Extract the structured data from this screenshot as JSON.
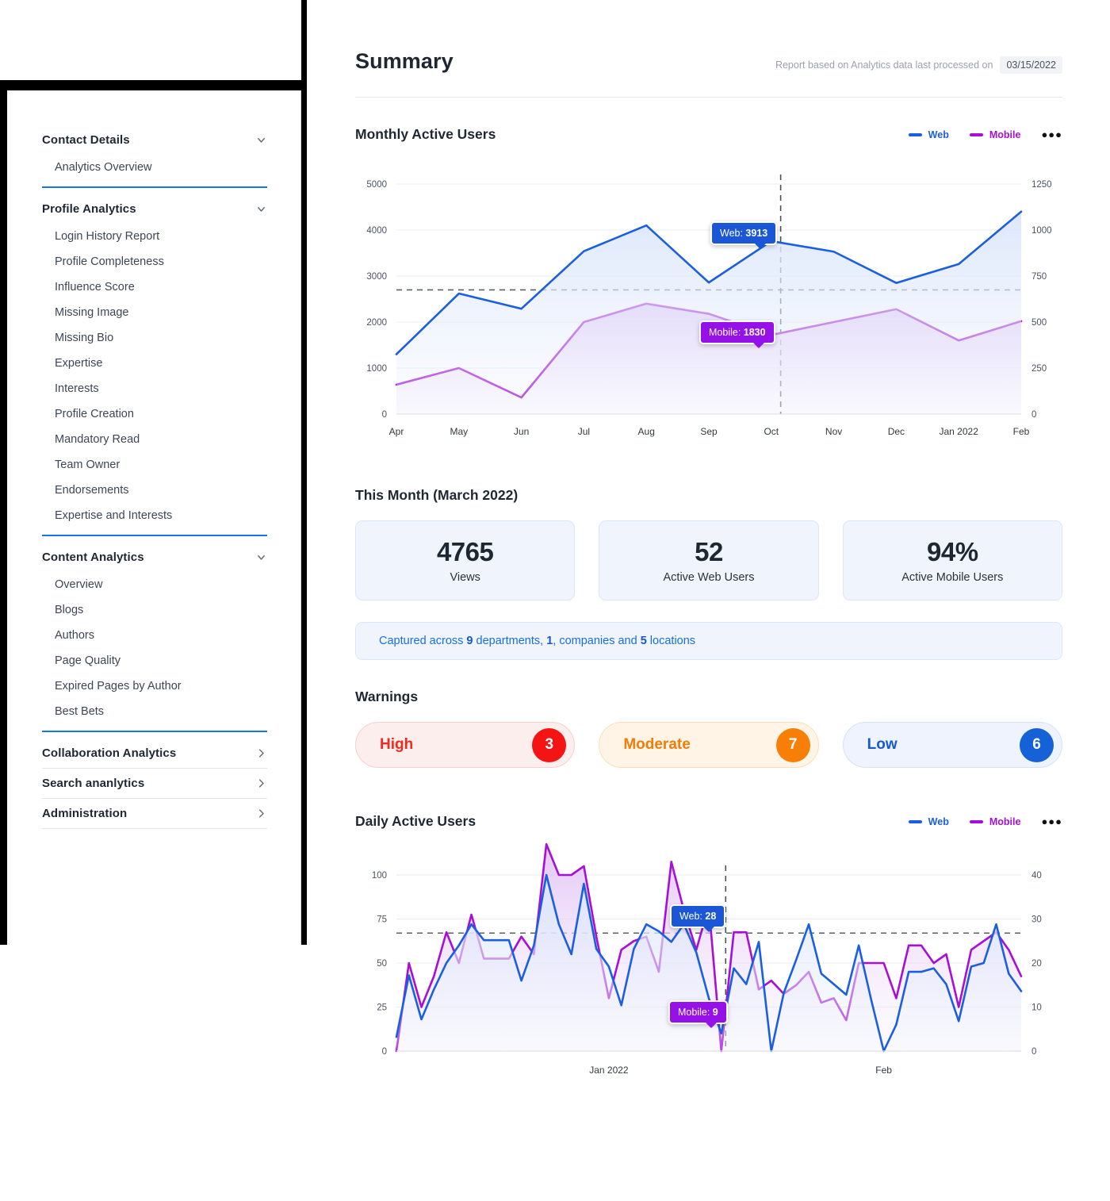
{
  "sidebar": {
    "groups": [
      {
        "title": "Contact Details",
        "icon": "chevron-down-icon",
        "expanded": true,
        "accent_rule": true,
        "items": [
          {
            "label": "Analytics Overview"
          }
        ]
      },
      {
        "title": "Profile Analytics",
        "icon": "chevron-down-icon",
        "expanded": true,
        "accent_rule": true,
        "items": [
          {
            "label": "Login History Report"
          },
          {
            "label": "Profile Completeness"
          },
          {
            "label": "Influence Score"
          },
          {
            "label": "Missing Image"
          },
          {
            "label": "Missing Bio"
          },
          {
            "label": "Expertise"
          },
          {
            "label": "Interests"
          },
          {
            "label": "Profile Creation"
          },
          {
            "label": "Mandatory Read"
          },
          {
            "label": "Team Owner"
          },
          {
            "label": "Endorsements"
          },
          {
            "label": "Expertise and Interests"
          }
        ]
      },
      {
        "title": "Content Analytics",
        "icon": "chevron-down-icon",
        "expanded": true,
        "accent_rule": true,
        "items": [
          {
            "label": "Overview"
          },
          {
            "label": "Blogs"
          },
          {
            "label": "Authors"
          },
          {
            "label": "Page Quality"
          },
          {
            "label": "Expired Pages by Author"
          },
          {
            "label": "Best Bets"
          }
        ]
      },
      {
        "title": "Collaboration Analytics",
        "icon": "chevron-right-icon",
        "expanded": false,
        "accent_rule": false,
        "items": []
      },
      {
        "title": "Search ananlytics",
        "icon": "chevron-right-icon",
        "expanded": false,
        "accent_rule": false,
        "items": []
      },
      {
        "title": "Administration",
        "icon": "chevron-right-icon",
        "expanded": false,
        "accent_rule": false,
        "items": []
      }
    ]
  },
  "header": {
    "title": "Summary",
    "report_note": "Report based on Analytics data last processed on",
    "report_date": "03/15/2022"
  },
  "monthly": {
    "title": "Monthly Active Users",
    "legend": [
      {
        "label": "Web",
        "color": "#1a5fe0"
      },
      {
        "label": "Mobile",
        "color": "#a70fd6"
      }
    ],
    "menu_icon": "more-horizontal-icon",
    "tooltip_web": {
      "prefix": "Web: ",
      "value": "3913"
    },
    "tooltip_mobile": {
      "prefix": "Mobile: ",
      "value": "1830"
    }
  },
  "this_month": {
    "title": "This Month (March 2022)",
    "cards": [
      {
        "value": "4765",
        "label": "Views"
      },
      {
        "value": "52",
        "label": "Active Web Users"
      },
      {
        "value": "94%",
        "label": "Active Mobile Users"
      }
    ],
    "capture": {
      "t1": "Captured across ",
      "n1": "9",
      "t2": " departments, ",
      "n2": "1",
      "t3": ", companies and ",
      "n3": "5",
      "t4": " locations"
    }
  },
  "warnings": {
    "title": "Warnings",
    "items": [
      {
        "label": "High",
        "count": "3",
        "color": "#f41414"
      },
      {
        "label": "Moderate",
        "count": "7",
        "color": "#f77f08"
      },
      {
        "label": "Low",
        "count": "6",
        "color": "#1561d8"
      }
    ]
  },
  "daily": {
    "title": "Daily Active Users",
    "legend": [
      {
        "label": "Web",
        "color": "#1a5fe0"
      },
      {
        "label": "Mobile",
        "color": "#a70fd6"
      }
    ],
    "menu_icon": "more-horizontal-icon",
    "tooltip_web": {
      "prefix": "Web: ",
      "value": "28"
    },
    "tooltip_mobile": {
      "prefix": "Mobile: ",
      "value": "9"
    }
  },
  "chart_data": [
    {
      "id": "monthly-active-users",
      "type": "area",
      "title": "Monthly Active Users",
      "xlabel": "",
      "ylabel": "",
      "grid": true,
      "legend_position": "top-right",
      "categories": [
        "Apr",
        "May",
        "Jun",
        "Jul",
        "Aug",
        "Sep",
        "Oct",
        "Nov",
        "Dec",
        "Jan 2022",
        "Feb"
      ],
      "y_left": {
        "ticks": [
          0,
          1000,
          2000,
          3000,
          4000,
          5000
        ],
        "ylim": [
          0,
          5000
        ]
      },
      "y_right": {
        "ticks": [
          0,
          250,
          500,
          750,
          1000,
          1250
        ],
        "ylim": [
          0,
          1250
        ]
      },
      "series": [
        {
          "name": "Web",
          "axis": "left",
          "color": "#1a5fe0",
          "values": [
            1300,
            2620,
            2290,
            3540,
            4100,
            2860,
            3760,
            3530,
            2850,
            3260,
            4400
          ]
        },
        {
          "name": "Mobile",
          "axis": "right",
          "color": "#a70fd6",
          "values": [
            160,
            250,
            90,
            500,
            600,
            545,
            430,
            500,
            570,
            400,
            505
          ]
        }
      ],
      "reference_line_y": 2700,
      "reference_line_x": "Oct+",
      "annotations": [
        {
          "series": "Web",
          "x": "Oct",
          "text": "Web: 3913"
        },
        {
          "series": "Mobile",
          "x": "Oct",
          "text": "Mobile: 1830"
        }
      ]
    },
    {
      "id": "daily-active-users",
      "type": "area",
      "title": "Daily Active Users",
      "xlabel": "",
      "ylabel": "",
      "grid": true,
      "legend_position": "top-right",
      "categories": [
        "Jan 2022",
        "Feb"
      ],
      "y_left": {
        "ticks": [
          0,
          25,
          50,
          75,
          100
        ],
        "ylim": [
          0,
          100
        ]
      },
      "y_right": {
        "ticks": [
          0,
          10,
          20,
          30,
          40
        ],
        "ylim": [
          0,
          40
        ]
      },
      "series": [
        {
          "name": "Web",
          "axis": "left",
          "color": "#1a5fe0",
          "values": [
            8,
            43,
            18,
            35,
            50,
            60,
            72,
            63,
            63,
            63,
            40,
            60,
            100,
            72,
            55,
            95,
            58,
            48,
            26,
            58,
            72,
            68,
            62,
            72,
            56,
            30,
            10,
            47,
            38,
            62,
            0,
            33,
            52,
            72,
            44,
            38,
            32,
            60,
            29,
            0,
            15,
            45,
            45,
            47,
            38,
            17,
            48,
            50,
            72,
            44,
            34
          ]
        },
        {
          "name": "Mobile",
          "axis": "right",
          "color": "#a70fd6",
          "values": [
            0,
            20,
            10,
            17,
            27,
            20,
            31,
            21,
            21,
            21,
            26,
            22,
            47,
            40,
            40,
            42,
            26,
            12,
            23,
            25,
            26,
            18,
            43,
            32,
            23,
            33,
            0,
            27,
            27,
            14,
            16,
            13,
            15,
            18,
            11,
            12,
            7,
            20,
            20,
            20,
            12,
            24,
            24,
            20,
            22,
            10,
            23,
            25,
            27,
            23,
            17
          ]
        }
      ],
      "reference_line_y": 67,
      "annotations": [
        {
          "series": "Web",
          "text": "Web: 28"
        },
        {
          "series": "Mobile",
          "text": "Mobile: 9"
        }
      ]
    }
  ]
}
